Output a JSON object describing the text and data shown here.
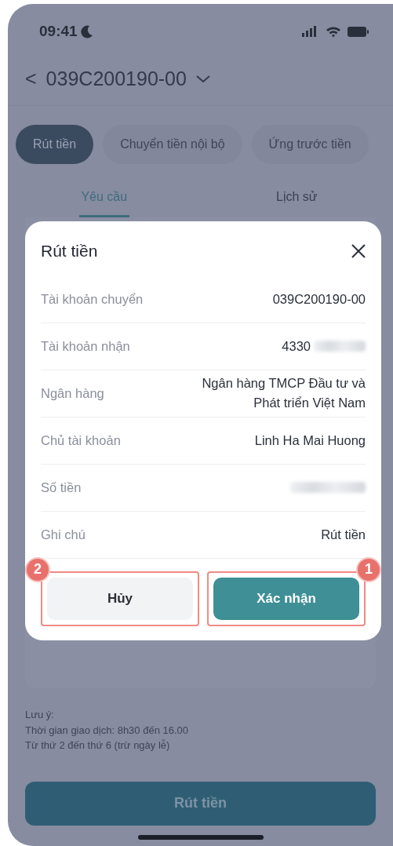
{
  "status_bar": {
    "time": "09:41"
  },
  "header": {
    "back_icon": "<",
    "account": "039C200190-00"
  },
  "segments": [
    {
      "label": "Rút tiền",
      "selected": true
    },
    {
      "label": "Chuyển tiền nội bộ",
      "selected": false
    },
    {
      "label": "Ứng trước tiền",
      "selected": false
    }
  ],
  "tabs": [
    {
      "label": "Yêu cầu",
      "selected": true
    },
    {
      "label": "Lịch sử",
      "selected": false
    }
  ],
  "dialog": {
    "title": "Rút tiền",
    "rows": [
      {
        "label": "Tài khoản chuyển",
        "value": "039C200190-00",
        "redacted": false
      },
      {
        "label": "Tài khoản nhận",
        "value": "4330",
        "redacted": true
      },
      {
        "label": "Ngân hàng",
        "value": "Ngân hàng TMCP Đầu tư và Phát triển Việt Nam",
        "redacted": false
      },
      {
        "label": "Chủ tài khoản",
        "value": "Linh Ha Mai Huong",
        "redacted": false
      },
      {
        "label": "Số tiền",
        "redacted": true
      },
      {
        "label": "Ghi chú",
        "value": "Rút tiền",
        "redacted": false
      }
    ],
    "buttons": [
      {
        "label": "Hủy",
        "kind": "secondary",
        "callout": "2"
      },
      {
        "label": "Xác nhận",
        "kind": "primary",
        "callout": "1"
      }
    ]
  },
  "note": {
    "title": "Lưu ý:",
    "lines": [
      "Thời gian giao dịch: 8h30 đến 16.00",
      "Từ thứ 2 đến thứ 6 (trừ ngày lễ)"
    ]
  },
  "submit_button": {
    "label": "Rút tiền",
    "disabled": true
  }
}
